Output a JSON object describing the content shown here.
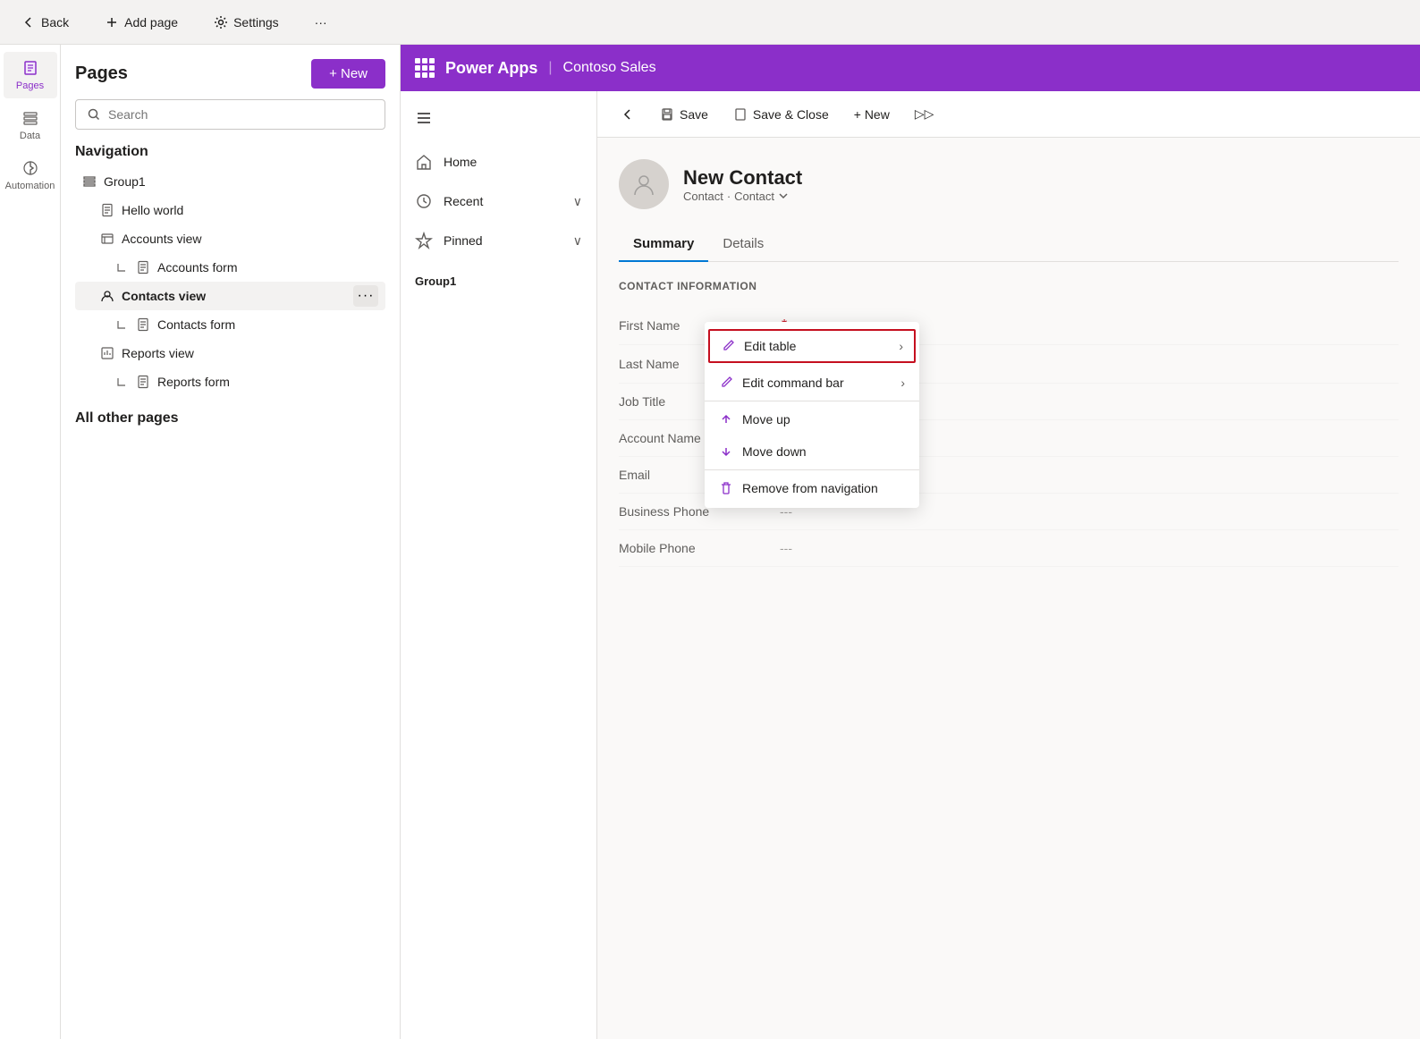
{
  "topbar": {
    "back_label": "Back",
    "add_page_label": "Add page",
    "settings_label": "Settings",
    "more_label": "···"
  },
  "icon_sidebar": {
    "items": [
      {
        "id": "pages",
        "label": "Pages",
        "active": true
      },
      {
        "id": "data",
        "label": "Data",
        "active": false
      },
      {
        "id": "automation",
        "label": "Automation",
        "active": false
      }
    ]
  },
  "pages_panel": {
    "title": "Pages",
    "new_label": "+ New",
    "search_placeholder": "Search",
    "navigation_title": "Navigation",
    "nav_items": [
      {
        "id": "group1",
        "label": "Group1",
        "type": "group",
        "indent": 0
      },
      {
        "id": "hello-world",
        "label": "Hello world",
        "type": "page",
        "indent": 1
      },
      {
        "id": "accounts-view",
        "label": "Accounts view",
        "type": "view",
        "indent": 1
      },
      {
        "id": "accounts-form",
        "label": "Accounts form",
        "type": "form",
        "indent": 2
      },
      {
        "id": "contacts-view",
        "label": "Contacts view",
        "type": "contact-view",
        "indent": 1,
        "active": true,
        "has_more": true
      },
      {
        "id": "contacts-form",
        "label": "Contacts form",
        "type": "form",
        "indent": 2
      },
      {
        "id": "reports-view",
        "label": "Reports view",
        "type": "report",
        "indent": 1
      },
      {
        "id": "reports-form",
        "label": "Reports form",
        "type": "form",
        "indent": 2
      }
    ],
    "all_other_pages_title": "All other pages"
  },
  "powerapps_header": {
    "app_icon": "⊞",
    "app_name": "Power Apps",
    "divider": "|",
    "env_name": "Contoso Sales"
  },
  "app_nav": {
    "items": [
      {
        "id": "home",
        "label": "Home"
      },
      {
        "id": "recent",
        "label": "Recent",
        "has_chevron": true
      },
      {
        "id": "pinned",
        "label": "Pinned",
        "has_chevron": true
      },
      {
        "id": "group1",
        "label": "Group1",
        "is_header": true
      }
    ]
  },
  "form_toolbar": {
    "back_label": "←",
    "save_label": "Save",
    "save_close_label": "Save & Close",
    "new_label": "+ New",
    "more_label": "▷▷"
  },
  "contact_form": {
    "name": "New Contact",
    "subtitle_type": "Contact",
    "subtitle_category": "Contact",
    "tabs": [
      {
        "id": "summary",
        "label": "Summary",
        "active": true
      },
      {
        "id": "details",
        "label": "Details",
        "active": false
      }
    ],
    "section_title": "CONTACT INFORMATION",
    "fields": [
      {
        "id": "first-name",
        "label": "First Name",
        "required": true,
        "value": "---"
      },
      {
        "id": "last-name",
        "label": "Last Name",
        "required": true,
        "value": "---"
      },
      {
        "id": "job-title",
        "label": "Job Title",
        "required": false,
        "value": "---"
      },
      {
        "id": "account-name",
        "label": "Account Name",
        "required": false,
        "value": "---"
      },
      {
        "id": "email",
        "label": "Email",
        "required": false,
        "value": "---"
      },
      {
        "id": "business-phone",
        "label": "Business Phone",
        "required": false,
        "value": "---"
      },
      {
        "id": "mobile-phone",
        "label": "Mobile Phone",
        "required": false,
        "value": "---"
      }
    ]
  },
  "context_menu": {
    "items": [
      {
        "id": "edit-table",
        "label": "Edit table",
        "has_arrow": true,
        "highlighted": true
      },
      {
        "id": "edit-command-bar",
        "label": "Edit command bar",
        "has_arrow": true
      },
      {
        "id": "move-up",
        "label": "Move up",
        "has_arrow": false
      },
      {
        "id": "move-down",
        "label": "Move down",
        "has_arrow": false
      },
      {
        "id": "remove-from-navigation",
        "label": "Remove from navigation",
        "has_arrow": false
      }
    ]
  },
  "colors": {
    "brand_purple": "#8b2fc9",
    "brand_blue": "#0078d4",
    "danger_red": "#c50f1f",
    "text_primary": "#201f1e",
    "text_secondary": "#605e5c",
    "border": "#e1dfdd",
    "bg_light": "#f3f2f1"
  }
}
